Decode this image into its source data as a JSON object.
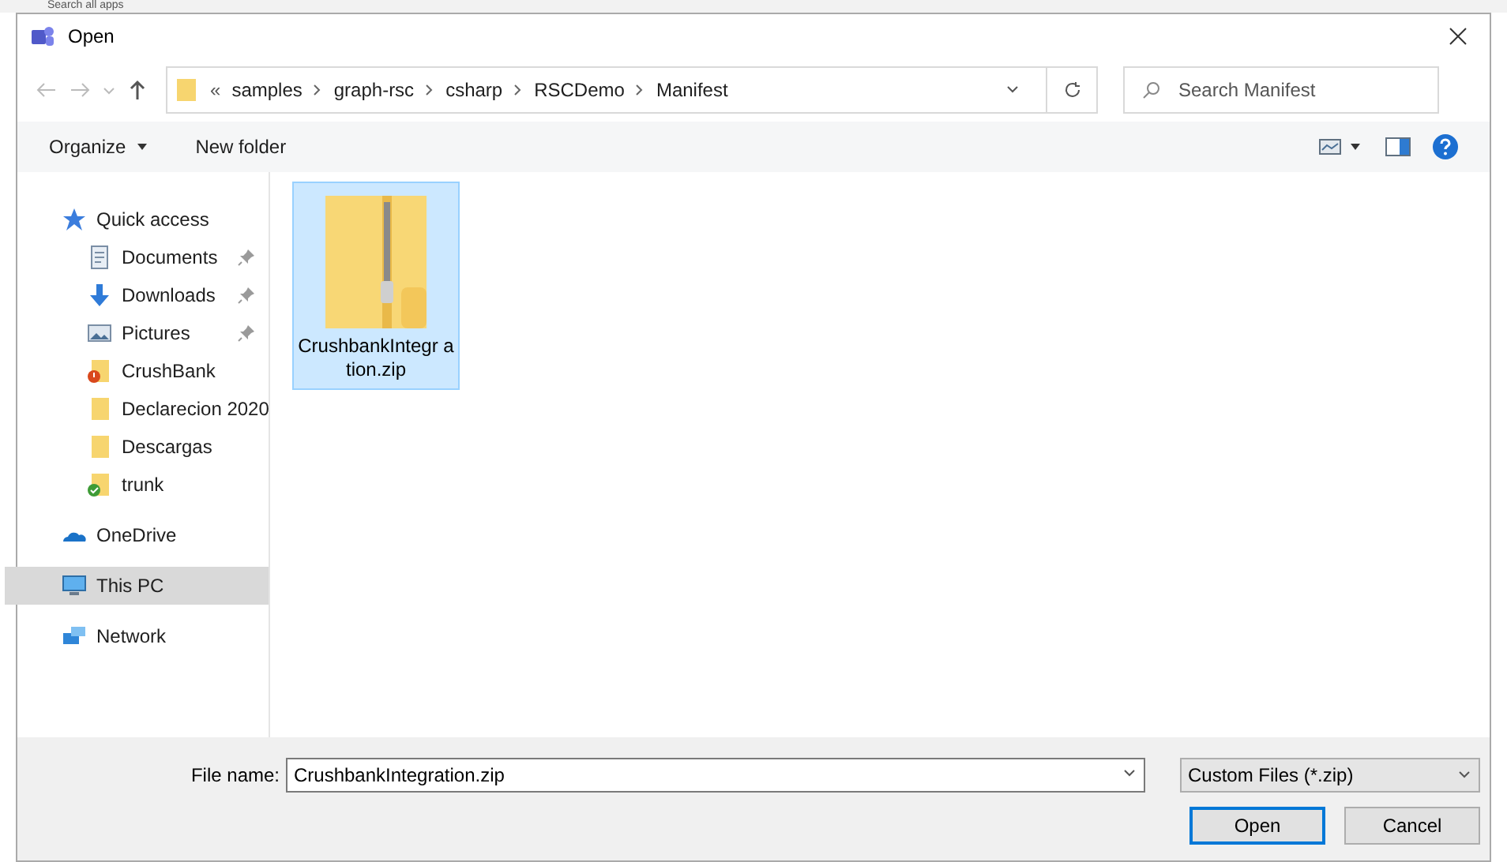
{
  "background_app": {
    "search_text": "Search all apps"
  },
  "window": {
    "title": "Open"
  },
  "address_bar": {
    "overflow": "«",
    "breadcrumbs": [
      "samples",
      "graph-rsc",
      "csharp",
      "RSCDemo",
      "Manifest"
    ]
  },
  "search": {
    "placeholder": "Search Manifest"
  },
  "toolbar": {
    "organize": "Organize",
    "new_folder": "New folder"
  },
  "sidebar": {
    "items": [
      {
        "label": "Quick access",
        "kind": "star",
        "selected": false,
        "children": [
          {
            "label": "Documents",
            "kind": "documents",
            "pinned": true,
            "selected": false
          },
          {
            "label": "Downloads",
            "kind": "download",
            "pinned": true,
            "selected": false
          },
          {
            "label": "Pictures",
            "kind": "pictures",
            "pinned": true,
            "selected": false
          },
          {
            "label": "CrushBank",
            "kind": "folder-error",
            "pinned": false,
            "selected": false
          },
          {
            "label": "Declarecion 2020",
            "kind": "folder",
            "pinned": false,
            "selected": false
          },
          {
            "label": "Descargas",
            "kind": "folder",
            "pinned": false,
            "selected": false
          },
          {
            "label": "trunk",
            "kind": "folder-ok",
            "pinned": false,
            "selected": false
          }
        ]
      },
      {
        "label": "OneDrive",
        "kind": "cloud",
        "selected": false
      },
      {
        "label": "This PC",
        "kind": "pc",
        "selected": true
      },
      {
        "label": "Network",
        "kind": "network",
        "selected": false
      }
    ]
  },
  "files": [
    {
      "name": "CrushbankIntegr ation.zip",
      "selected": true
    }
  ],
  "footer": {
    "file_name_label": "File name:",
    "file_name": "CrushbankIntegration.zip",
    "file_type": "Custom Files (*.zip)",
    "buttons": [
      "Open",
      "Cancel"
    ]
  }
}
